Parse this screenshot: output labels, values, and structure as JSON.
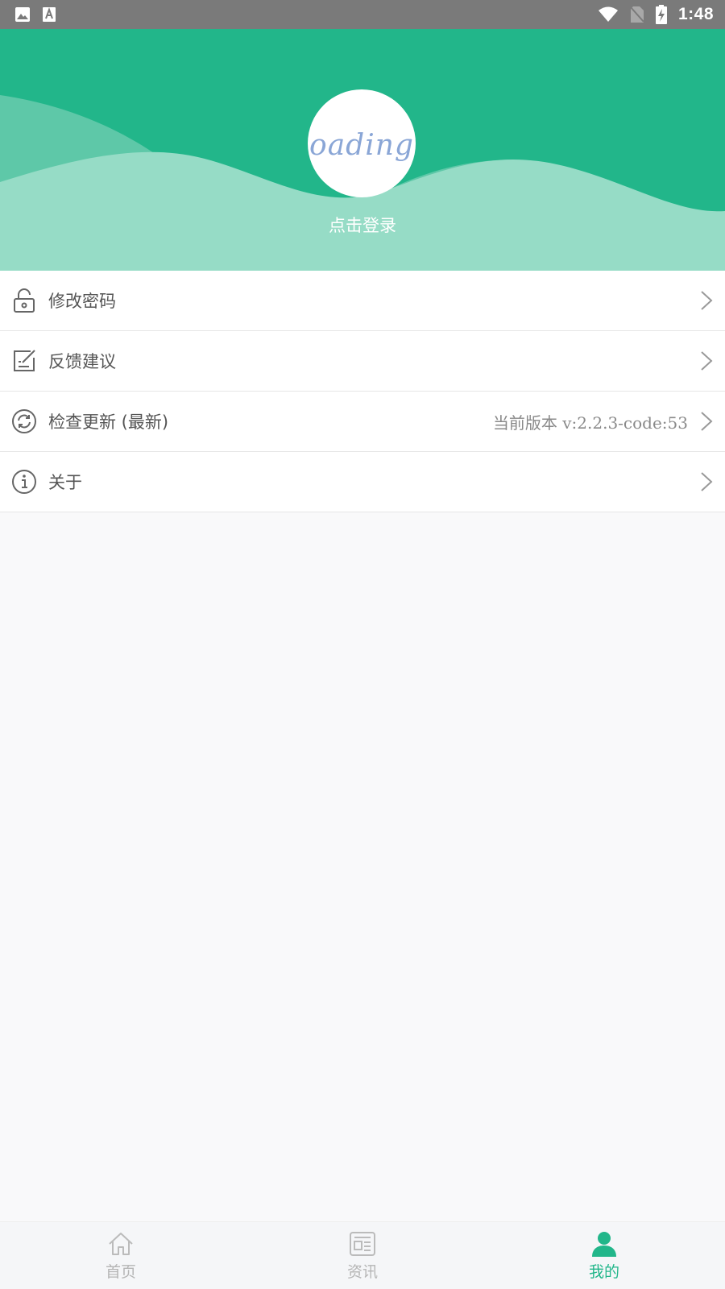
{
  "status_bar": {
    "time": "1:48",
    "left_icons": [
      "image-icon",
      "font-icon"
    ],
    "right_icons": [
      "wifi-icon",
      "no-sim-icon",
      "battery-charging-icon"
    ]
  },
  "header": {
    "avatar_text": "oading",
    "login_label": "点击登录",
    "colors": {
      "primary": "#22b68a",
      "wave_mid": "#5ec8a8",
      "wave_light": "#96dcc6"
    }
  },
  "menu": {
    "items": [
      {
        "icon": "lock-open-icon",
        "label": "修改密码",
        "value": ""
      },
      {
        "icon": "feedback-edit-icon",
        "label": "反馈建议",
        "value": ""
      },
      {
        "icon": "refresh-icon",
        "label": "检查更新 (最新)",
        "value": "当前版本  v:2.2.3-code:53"
      },
      {
        "icon": "info-icon",
        "label": "关于",
        "value": ""
      }
    ]
  },
  "bottom_nav": {
    "items": [
      {
        "icon": "home-icon",
        "label": "首页",
        "active": false
      },
      {
        "icon": "news-icon",
        "label": "资讯",
        "active": false
      },
      {
        "icon": "user-icon",
        "label": "我的",
        "active": true
      }
    ]
  }
}
